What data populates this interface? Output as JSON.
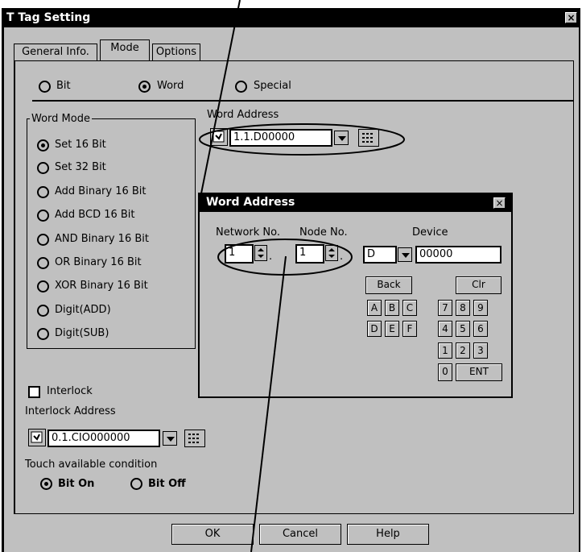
{
  "window": {
    "title": "T Tag Setting",
    "close_glyph": "×"
  },
  "tabs": [
    {
      "label": "General Info."
    },
    {
      "label": "Mode"
    },
    {
      "label": "Options"
    }
  ],
  "mode_radios": [
    {
      "label": "Bit",
      "selected": false
    },
    {
      "label": "Word",
      "selected": true
    },
    {
      "label": "Special",
      "selected": false
    }
  ],
  "word_mode": {
    "group_label": "Word Mode",
    "options": [
      {
        "label": "Set 16 Bit",
        "selected": true
      },
      {
        "label": "Set 32 Bit",
        "selected": false
      },
      {
        "label": "Add Binary 16 Bit",
        "selected": false
      },
      {
        "label": "Add BCD 16 Bit",
        "selected": false
      },
      {
        "label": "AND Binary 16 Bit",
        "selected": false
      },
      {
        "label": "OR Binary 16 Bit",
        "selected": false
      },
      {
        "label": "XOR Binary 16 Bit",
        "selected": false
      },
      {
        "label": "Digit(ADD)",
        "selected": false
      },
      {
        "label": "Digit(SUB)",
        "selected": false
      }
    ]
  },
  "word_address": {
    "label": "Word Address",
    "value": "1.1.D00000"
  },
  "interlock": {
    "checkbox_label": "Interlock",
    "address_label": "Interlock Address",
    "address_value": "0.1.CIO000000",
    "checked": false
  },
  "touch": {
    "label": "Touch available condition",
    "options": [
      {
        "label": "Bit On",
        "selected": true
      },
      {
        "label": "Bit Off",
        "selected": false
      }
    ]
  },
  "buttons": {
    "ok": "OK",
    "cancel": "Cancel",
    "help": "Help"
  },
  "popup": {
    "title": "Word Address",
    "close_glyph": "×",
    "network_label": "Network No.",
    "node_label": "Node No.",
    "device_label": "Device",
    "network_value": "1",
    "node_value": "1",
    "separator": ".",
    "device_value": "D",
    "address_value": "00000",
    "keys": {
      "back": "Back",
      "clr": "Clr",
      "a": "A",
      "b": "B",
      "c": "C",
      "d": "D",
      "e": "E",
      "f": "F",
      "n0": "0",
      "n1": "1",
      "n2": "2",
      "n3": "3",
      "n4": "4",
      "n5": "5",
      "n6": "6",
      "n7": "7",
      "n8": "8",
      "n9": "9",
      "ent": "ENT"
    }
  },
  "icons": {
    "address_picker": "device-picker-icon",
    "keypad": "keypad-icon",
    "dropdown": "dropdown-arrow-icon",
    "spinner": "spinner-icon"
  },
  "colors": {
    "dialog_bg": "#c0c0c0",
    "titlebar_bg": "#000000",
    "field_bg": "#ffffff"
  }
}
